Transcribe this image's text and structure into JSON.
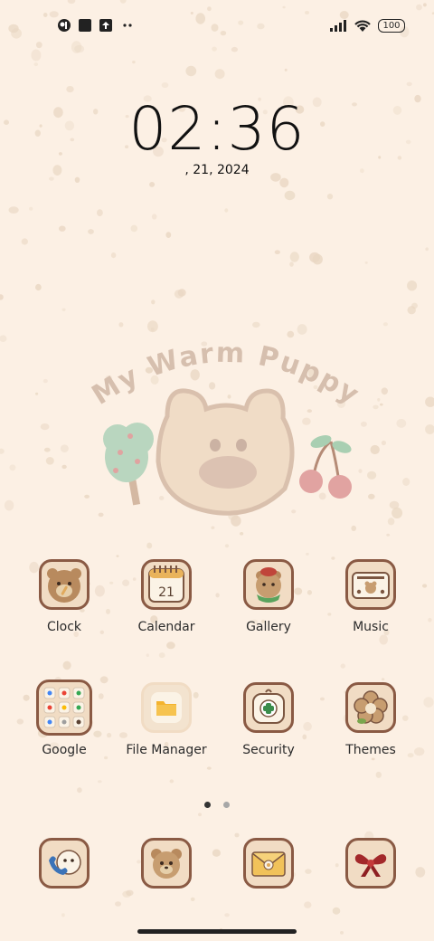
{
  "status_bar": {
    "left_icons": [
      "notification-app-icon",
      "notification-square-icon",
      "upload-icon",
      "more-dots-icon"
    ],
    "battery": "100",
    "right_icons": [
      "signal-icon",
      "wifi-icon",
      "battery-icon"
    ]
  },
  "clock": {
    "time": "02:36",
    "date": ", 21, 2024"
  },
  "wallpaper": {
    "title": "My Warm Puppy"
  },
  "apps": [
    {
      "label": "Clock",
      "icon": "bear-clock-icon"
    },
    {
      "label": "Calendar",
      "icon": "calendar-icon",
      "icon_text": "21"
    },
    {
      "label": "Gallery",
      "icon": "gallery-icon"
    },
    {
      "label": "Music",
      "icon": "music-icon"
    },
    {
      "label": "Google",
      "icon": "google-folder-icon"
    },
    {
      "label": "File Manager",
      "icon": "folder-icon"
    },
    {
      "label": "Security",
      "icon": "security-icon"
    },
    {
      "label": "Themes",
      "icon": "flower-icon"
    }
  ],
  "page_indicator": {
    "pages": 2,
    "active": 0
  },
  "dock": [
    {
      "icon": "phone-icon"
    },
    {
      "icon": "puppy-messages-icon"
    },
    {
      "icon": "envelope-icon"
    },
    {
      "icon": "bow-icon"
    }
  ],
  "colors": {
    "background": "#fcf0e4",
    "tile": "#f1dcc4",
    "border": "#8a5a44",
    "speckle": "#e9d7c3",
    "art_text": "#cfb6a6"
  }
}
